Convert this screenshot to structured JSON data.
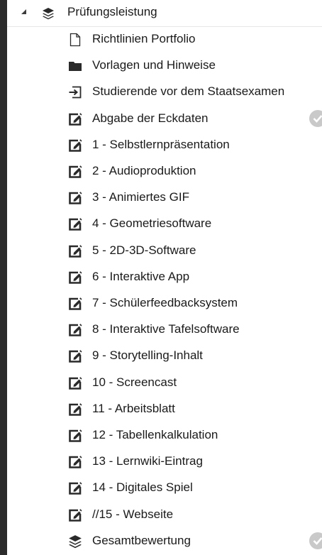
{
  "section": {
    "label": "Prüfungsleistung",
    "icon": "layers-icon",
    "expand_icon": "triangle-expanded-icon"
  },
  "items": [
    {
      "label": "Richtlinien Portfolio",
      "icon": "page-icon",
      "completed": false
    },
    {
      "label": "Vorlagen und Hinweise",
      "icon": "folder-icon",
      "completed": false
    },
    {
      "label": "Studierende vor dem Staatsexamen",
      "icon": "enrol-icon",
      "completed": false
    },
    {
      "label": "Abgabe der Eckdaten",
      "icon": "assignment-icon",
      "completed": true
    },
    {
      "label": "1 - Selbstlernpräsentation",
      "icon": "assignment-icon",
      "completed": false
    },
    {
      "label": "2 - Audioproduktion",
      "icon": "assignment-icon",
      "completed": false
    },
    {
      "label": "3 - Animiertes GIF",
      "icon": "assignment-icon",
      "completed": false
    },
    {
      "label": "4 - Geometriesoftware",
      "icon": "assignment-icon",
      "completed": false
    },
    {
      "label": "5 - 2D-3D-Software",
      "icon": "assignment-icon",
      "completed": false
    },
    {
      "label": "6 - Interaktive App",
      "icon": "assignment-icon",
      "completed": false
    },
    {
      "label": "7 - Schülerfeedbacksystem",
      "icon": "assignment-icon",
      "completed": false
    },
    {
      "label": "8 - Interaktive Tafelsoftware",
      "icon": "assignment-icon",
      "completed": false
    },
    {
      "label": "9 - Storytelling-Inhalt",
      "icon": "assignment-icon",
      "completed": false
    },
    {
      "label": "10 - Screencast",
      "icon": "assignment-icon",
      "completed": false
    },
    {
      "label": "11 - Arbeitsblatt",
      "icon": "assignment-icon",
      "completed": false
    },
    {
      "label": "12 - Tabellenkalkulation",
      "icon": "assignment-icon",
      "completed": false
    },
    {
      "label": "13 - Lernwiki-Eintrag",
      "icon": "assignment-icon",
      "completed": false
    },
    {
      "label": "14 - Digitales Spiel",
      "icon": "assignment-icon",
      "completed": false
    },
    {
      "label": "//15 - Webseite",
      "icon": "assignment-icon",
      "completed": false
    },
    {
      "label": "Gesamtbewertung",
      "icon": "layers-icon",
      "completed": true
    }
  ],
  "colors": {
    "background": "#2b2b2b",
    "panel": "#ffffff",
    "text": "#1a1a1a",
    "check": "#c9c9c9"
  }
}
